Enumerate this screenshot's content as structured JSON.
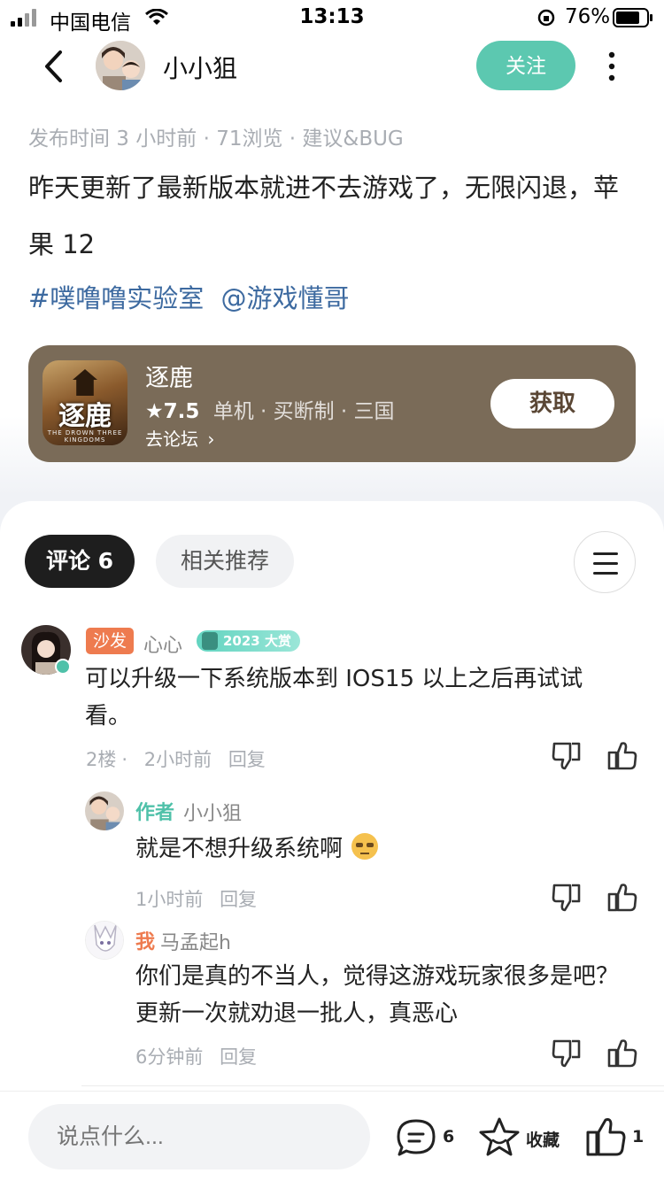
{
  "status_bar": {
    "carrier": "中国电信",
    "time": "13:13",
    "battery": "76%"
  },
  "nav": {
    "username": "小小狙",
    "follow_label": "关注"
  },
  "post": {
    "meta": "发布时间 3 小时前 · 71浏览 · 建议&BUG",
    "content": "昨天更新了最新版本就进不去游戏了，无限闪退，苹果 12",
    "tags": [
      "#噗噜噜实验室",
      "@游戏懂哥"
    ]
  },
  "game_card": {
    "name": "逐鹿",
    "icon_text": "逐鹿",
    "icon_sub": "THE DROWN THREE KINGDOMS",
    "rating": "7.5",
    "meta": "单机 · 买断制 · 三国",
    "forum_link": "去论坛",
    "get_label": "获取"
  },
  "tabs": {
    "comments": "评论 6",
    "related": "相关推荐"
  },
  "comments": [
    {
      "badge": "沙发",
      "username": "心心",
      "award": "2023 大赏",
      "text": "可以升级一下系统版本到 IOS15 以上之后再试试看。",
      "floor": "2楼",
      "time": "2小时前",
      "reply_label": "回复"
    }
  ],
  "replies": [
    {
      "tag": "作者",
      "username": "小小狙",
      "text": "就是不想升级系统啊",
      "time": "1小时前",
      "reply_label": "回复"
    },
    {
      "tag": "我",
      "username": "马孟起h",
      "text": "你们是真的不当人，觉得这游戏玩家很多是吧？更新一次就劝退一批人，真恶心",
      "time": "6分钟前",
      "reply_label": "回复"
    }
  ],
  "bottom_bar": {
    "placeholder": "说点什么...",
    "comment_count": "6",
    "favorite_label": "收藏",
    "like_count": "1"
  },
  "colors": {
    "accent": "#5cc8b0",
    "card": "#7a6b58",
    "link": "#3d6aa0",
    "sofa": "#ee7b4f"
  }
}
